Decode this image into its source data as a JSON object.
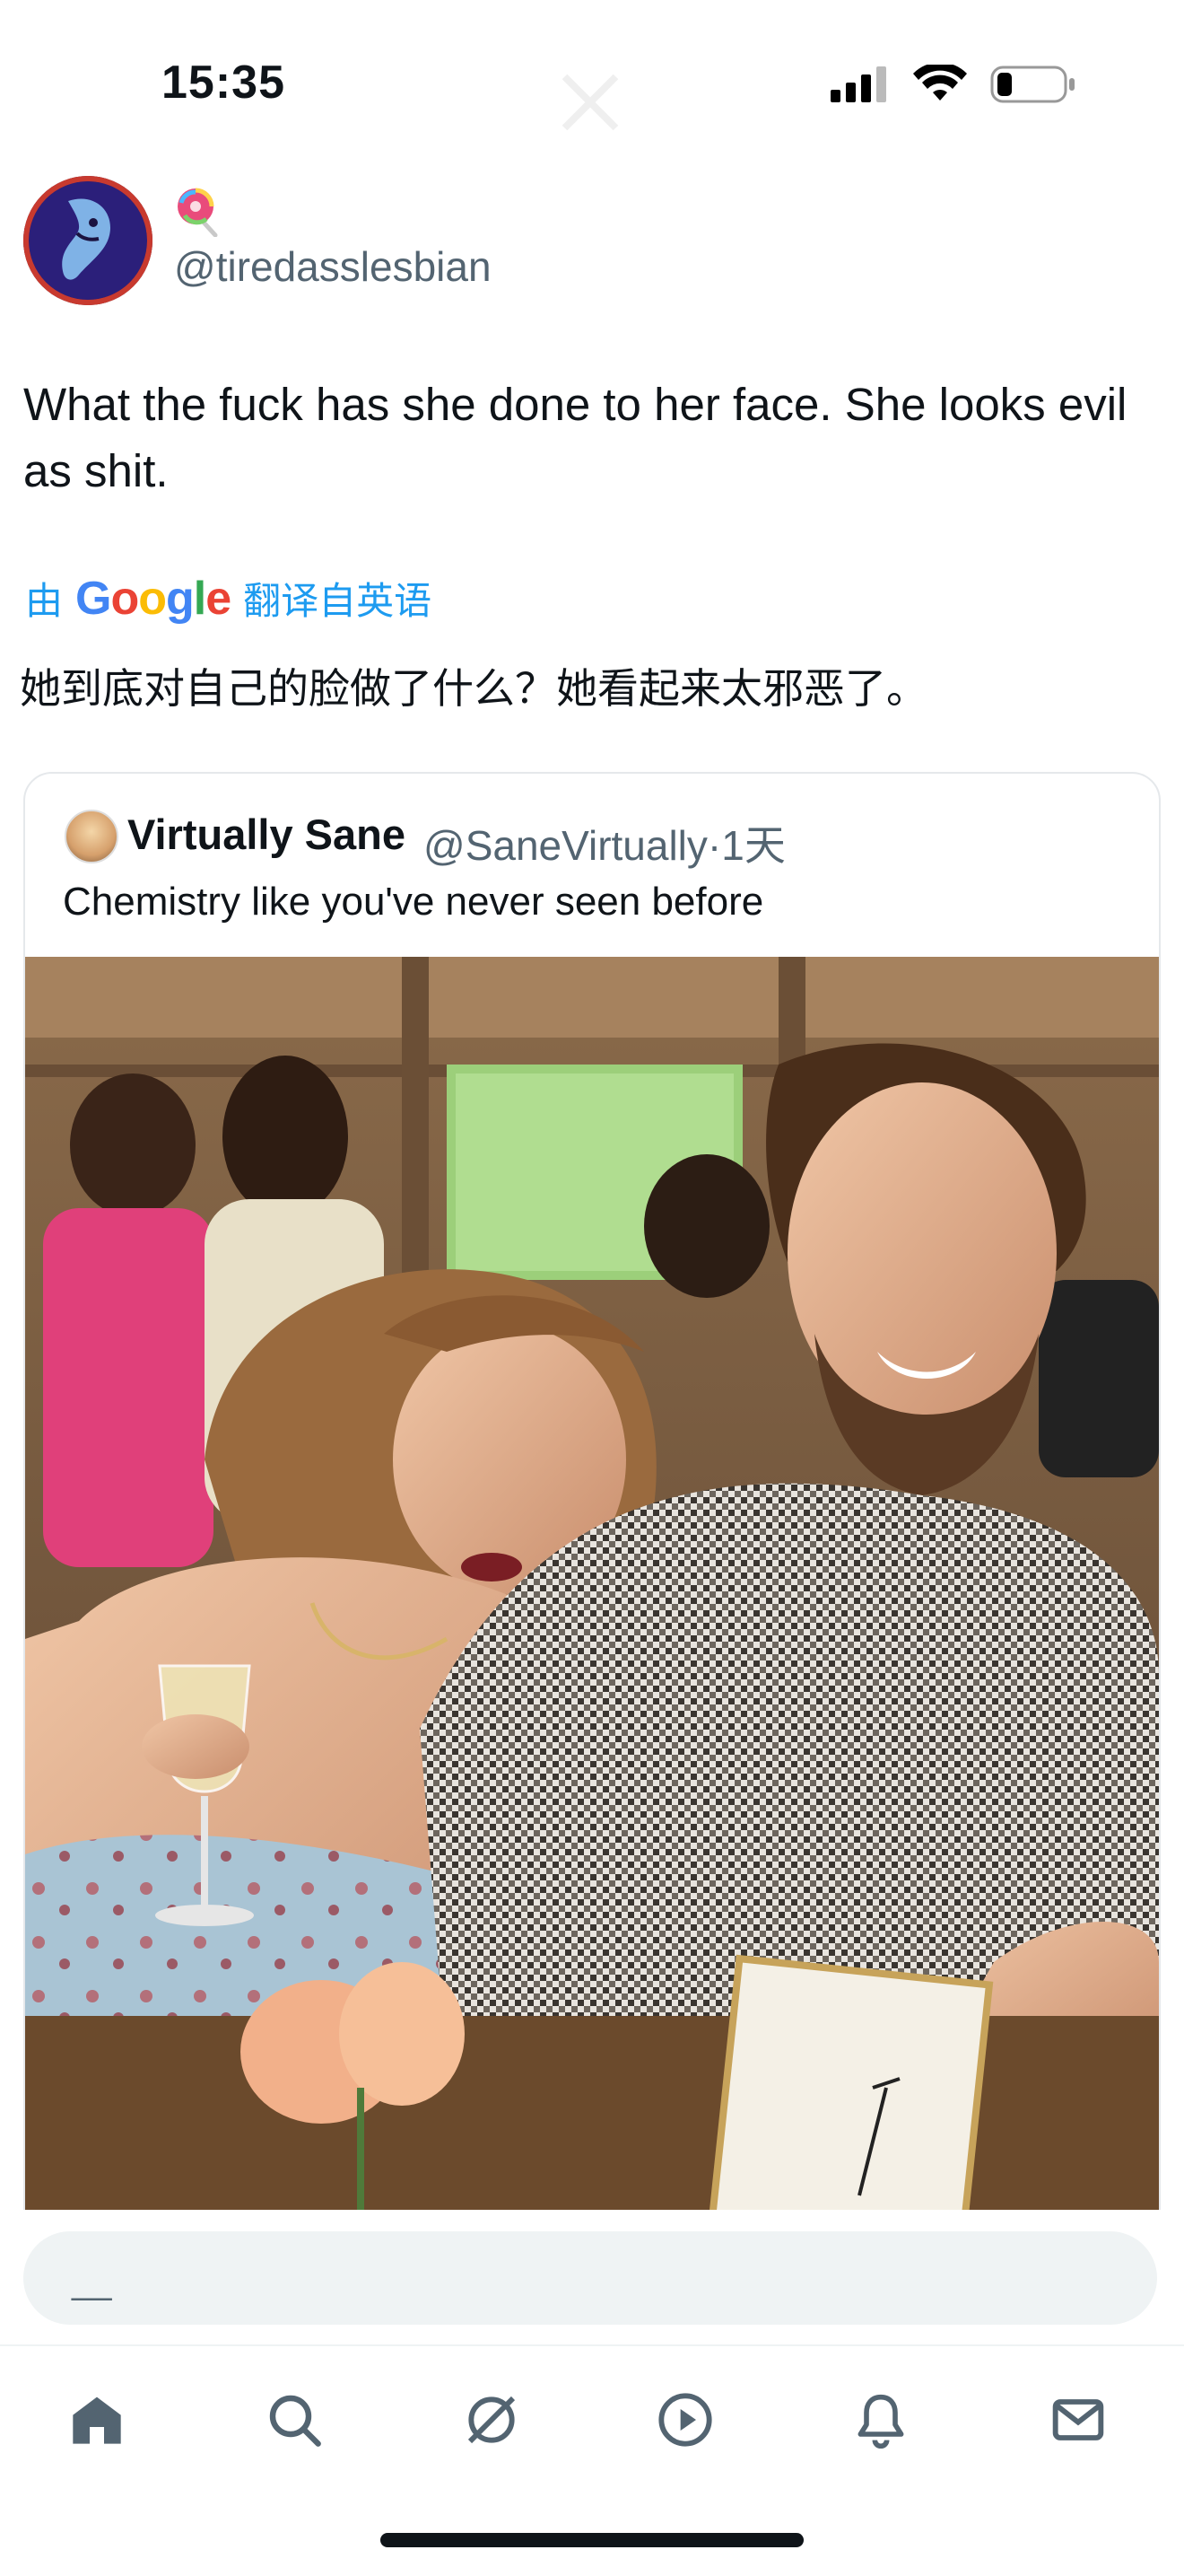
{
  "status_bar": {
    "time": "15:35"
  },
  "tweet": {
    "handle": "@tiredasslesbian",
    "display_emoji_icon": "lollipop-emoji",
    "text": "What the fuck has she done to her face. She looks evil as shit.",
    "translated_prefix": "由",
    "translated_brand": "Google",
    "translated_suffix": "翻译自英语",
    "translation": "她到底对自己的脸做了什么？她看起来太邪恶了。"
  },
  "quote": {
    "name": "Virtually Sane",
    "handle": "@SaneVirtually",
    "separator": "·",
    "time": "1天",
    "text": "Chemistry like you've never seen before"
  },
  "reply": {
    "placeholder": "__"
  },
  "nav": {
    "items": [
      {
        "icon": "home-icon"
      },
      {
        "icon": "search-icon"
      },
      {
        "icon": "grok-icon"
      },
      {
        "icon": "video-icon"
      },
      {
        "icon": "bell-icon"
      },
      {
        "icon": "mail-icon"
      }
    ]
  },
  "colors": {
    "link": "#1d9bf0",
    "secondary_text": "#536471",
    "primary_text": "#0f1419",
    "input_bg": "#eff3f4"
  }
}
